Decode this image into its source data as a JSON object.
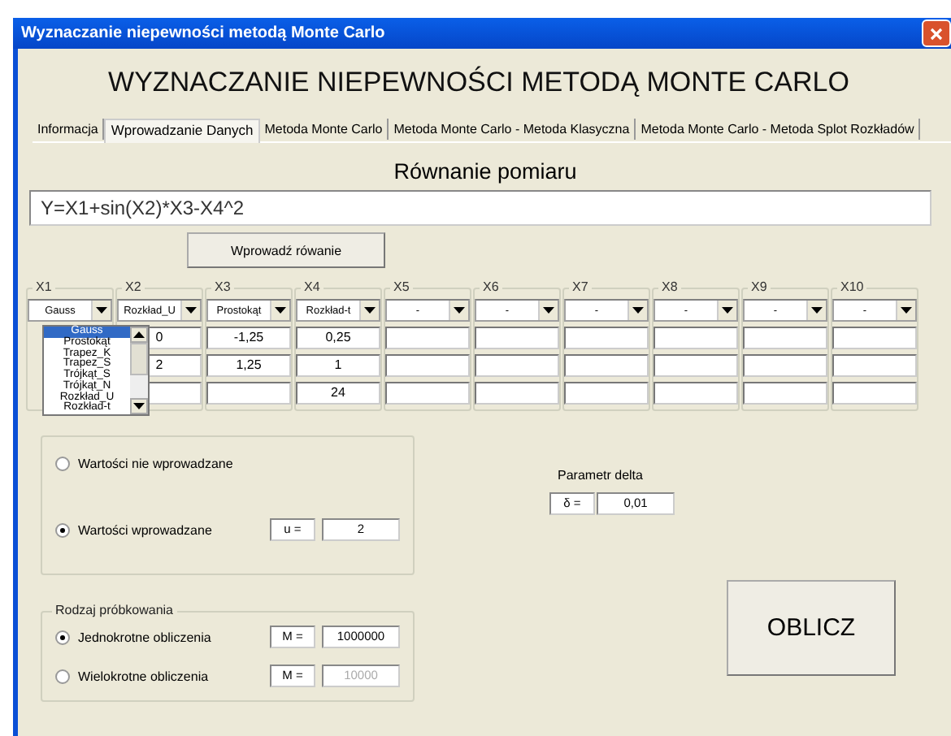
{
  "window": {
    "title": "Wyznaczanie niepewności metodą Monte Carlo"
  },
  "heading": "WYZNACZANIE NIEPEWNOŚCI METODĄ MONTE CARLO",
  "tabs": [
    {
      "label": "Informacja",
      "selected": false
    },
    {
      "label": "Wprowadzanie Danych",
      "selected": true
    },
    {
      "label": "Metoda Monte Carlo",
      "selected": false
    },
    {
      "label": "Metoda Monte Carlo - Metoda Klasyczna",
      "selected": false
    },
    {
      "label": "Metoda Monte Carlo - Metoda Splot Rozkładów",
      "selected": false
    }
  ],
  "equation": {
    "label": "Równanie pomiaru",
    "value": "Y=X1+sin(X2)*X3-X4^2",
    "button": "Wprowadź rówanie"
  },
  "columns": [
    {
      "label": "X1",
      "distribution": "Gauss",
      "open_list": [
        {
          "label": "Gauss",
          "selected": true
        },
        {
          "label": "Prostokąt",
          "selected": false
        },
        {
          "label": "Trapez_K",
          "selected": false
        },
        {
          "label": "Trapez_S",
          "selected": false
        },
        {
          "label": "Trójkąt_S",
          "selected": false
        },
        {
          "label": "Trójkąt_N",
          "selected": false
        },
        {
          "label": "Rozkład_U",
          "selected": false
        },
        {
          "label": "Rozkład-t",
          "selected": false
        }
      ]
    },
    {
      "label": "X2",
      "distribution": "Rozkład_U",
      "values": [
        "0",
        "2"
      ]
    },
    {
      "label": "X3",
      "distribution": "Prostokąt",
      "values": [
        "-1,25",
        "1,25"
      ]
    },
    {
      "label": "X4",
      "distribution": "Rozkład-t",
      "values": [
        "0,25",
        "1",
        "24"
      ]
    },
    {
      "label": "X5",
      "distribution": "-"
    },
    {
      "label": "X6",
      "distribution": "-"
    },
    {
      "label": "X7",
      "distribution": "-"
    },
    {
      "label": "X8",
      "distribution": "-"
    },
    {
      "label": "X9",
      "distribution": "-"
    },
    {
      "label": "X10",
      "distribution": "-"
    }
  ],
  "values_group": {
    "options": [
      {
        "label": "Wartości nie wprowadzane",
        "selected": false
      },
      {
        "label": "Wartości wprowadzane",
        "selected": true,
        "field_label": "u =",
        "value": "2"
      }
    ]
  },
  "delta": {
    "label": "Parametr delta",
    "field_label": "δ =",
    "value": "0,01"
  },
  "sampling": {
    "title": "Rodzaj próbkowania",
    "options": [
      {
        "label": "Jednokrotne obliczenia",
        "selected": true,
        "field_label": "M =",
        "value": "1000000",
        "disabled": false
      },
      {
        "label": "Wielokrotne obliczenia",
        "selected": false,
        "field_label": "M =",
        "value": "10000",
        "disabled": true
      }
    ]
  },
  "compute_button": "OBLICZ"
}
